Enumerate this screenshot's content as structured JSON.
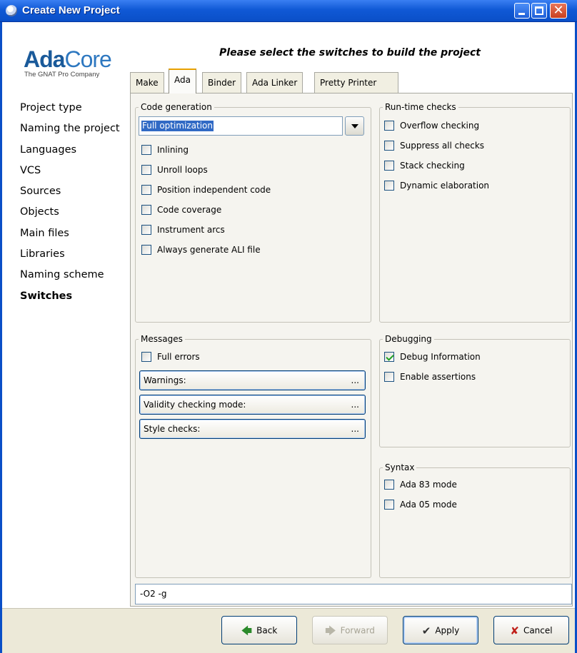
{
  "window": {
    "title": "Create New Project",
    "icon": "gnat-icon",
    "controls": {
      "minimize": "",
      "maximize": "",
      "close": "✕"
    }
  },
  "logo": {
    "name_a": "Ada",
    "name_b": "Core",
    "tagline": "The GNAT Pro Company"
  },
  "heading": "Please select the switches to build the project",
  "sidebar": {
    "items": [
      {
        "label": "Project type",
        "active": false
      },
      {
        "label": "Naming the project",
        "active": false
      },
      {
        "label": "Languages",
        "active": false
      },
      {
        "label": "VCS",
        "active": false
      },
      {
        "label": "Sources",
        "active": false
      },
      {
        "label": "Objects",
        "active": false
      },
      {
        "label": "Main files",
        "active": false
      },
      {
        "label": "Libraries",
        "active": false
      },
      {
        "label": "Naming scheme",
        "active": false
      },
      {
        "label": "Switches",
        "active": true
      }
    ]
  },
  "tabs": [
    {
      "label": "Make",
      "active": false
    },
    {
      "label": "Ada",
      "active": true
    },
    {
      "label": "Binder",
      "active": false
    },
    {
      "label": "Ada Linker",
      "active": false
    },
    {
      "label": "Pretty Printer",
      "active": false
    }
  ],
  "code_generation": {
    "title": "Code generation",
    "optimization": {
      "selected": "Full optimization"
    },
    "options": [
      {
        "label": "Inlining",
        "checked": false
      },
      {
        "label": "Unroll loops",
        "checked": false
      },
      {
        "label": "Position independent code",
        "checked": false
      },
      {
        "label": "Code coverage",
        "checked": false
      },
      {
        "label": "Instrument arcs",
        "checked": false
      },
      {
        "label": "Always generate ALI file",
        "checked": false
      }
    ]
  },
  "runtime_checks": {
    "title": "Run-time checks",
    "options": [
      {
        "label": "Overflow checking",
        "checked": false
      },
      {
        "label": "Suppress all checks",
        "checked": false
      },
      {
        "label": "Stack checking",
        "checked": false
      },
      {
        "label": "Dynamic elaboration",
        "checked": false
      }
    ]
  },
  "messages": {
    "title": "Messages",
    "full_errors": {
      "label": "Full errors",
      "checked": false
    },
    "expanders": [
      {
        "label": "Warnings:",
        "dots": "..."
      },
      {
        "label": "Validity checking mode:",
        "dots": "..."
      },
      {
        "label": "Style checks:",
        "dots": "..."
      }
    ]
  },
  "debugging": {
    "title": "Debugging",
    "options": [
      {
        "label": "Debug Information",
        "checked": true
      },
      {
        "label": "Enable assertions",
        "checked": false
      }
    ]
  },
  "syntax": {
    "title": "Syntax",
    "options": [
      {
        "label": "Ada 83 mode",
        "checked": false
      },
      {
        "label": "Ada 05 mode",
        "checked": false
      }
    ]
  },
  "command_line": "-O2 -g",
  "buttons": {
    "back": {
      "label": "Back",
      "icon": "arrow-left-icon",
      "enabled": true
    },
    "forward": {
      "label": "Forward",
      "icon": "arrow-right-icon",
      "enabled": false
    },
    "apply": {
      "label": "Apply",
      "icon": "checkmark-icon",
      "enabled": true
    },
    "cancel": {
      "label": "Cancel",
      "icon": "cross-icon",
      "enabled": true
    }
  }
}
